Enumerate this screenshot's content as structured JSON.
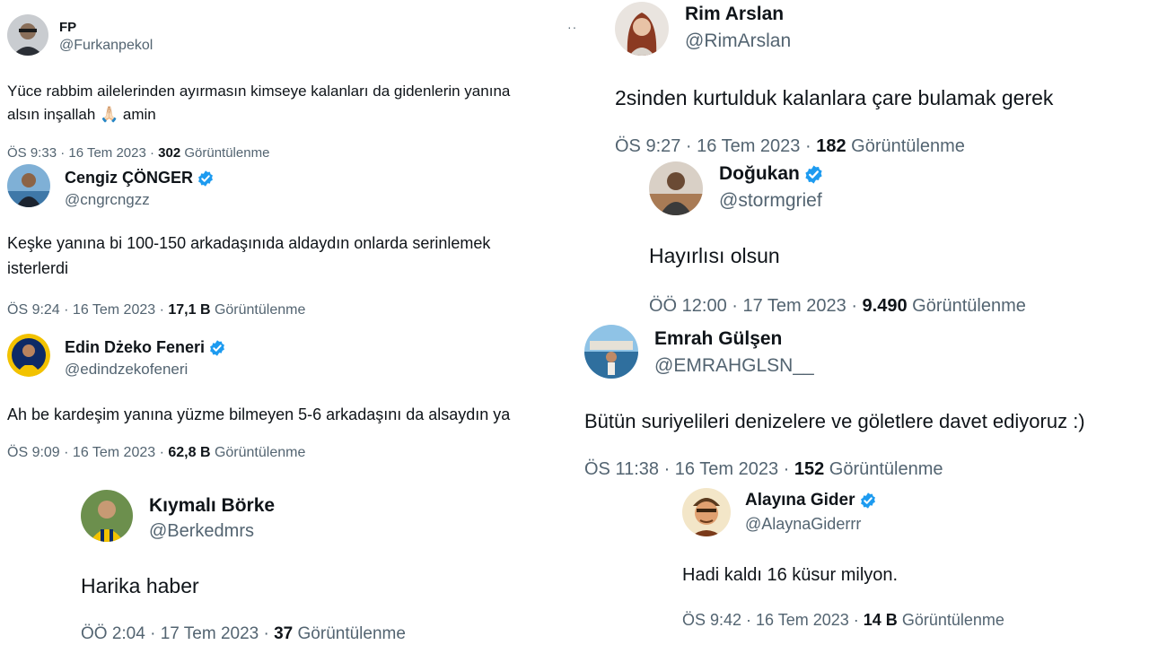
{
  "tweets": [
    {
      "name": "FP",
      "handle": "@Furkanpekol",
      "verified": false,
      "text_lines": [
        "Yüce rabbim ailelerinden ayırmasın kimseye kalanları da gidenlerin yanına",
        "alsın inşallah 🙏🏻 amin"
      ],
      "time": "ÖS 9:33 · 16 Tem 2023 · ",
      "views": "302",
      "views_label": " Görüntülenme",
      "more": "··"
    },
    {
      "name": "Cengiz ÇÖNGER",
      "handle": "@cngrcngzz",
      "verified": true,
      "text_lines": [
        "Keşke yanına bi 100-150 arkadaşınıda aldaydın onlarda serinlemek",
        "isterlerdi"
      ],
      "time": "ÖS 9:24 · 16 Tem 2023 · ",
      "views": "17,1 B",
      "views_label": " Görüntülenme"
    },
    {
      "name": "Edin Dżeko Feneri",
      "handle": "@edindzekofeneri",
      "verified": true,
      "text_lines": [
        "Ah be kardeşim yanına yüzme bilmeyen 5-6 arkadaşını da alsaydın ya"
      ],
      "time": "ÖS 9:09 · 16 Tem 2023 · ",
      "views": "62,8 B",
      "views_label": " Görüntülenme"
    },
    {
      "name": "Kıymalı Börke",
      "handle": "@Berkedmrs",
      "verified": false,
      "text_lines": [
        "Harika haber"
      ],
      "time": "ÖÖ 2:04 · 17 Tem 2023 · ",
      "views": "37",
      "views_label": " Görüntülenme"
    },
    {
      "name": "Rim Arslan",
      "handle": "@RimArslan",
      "verified": false,
      "text_lines": [
        "2sinden kurtulduk kalanlara çare bulamak gerek"
      ],
      "time": "ÖS 9:27 · 16 Tem 2023 · ",
      "views": "182",
      "views_label": " Görüntülenme"
    },
    {
      "name": "Doğukan",
      "handle": "@stormgrief",
      "verified": true,
      "text_lines": [
        "Hayırlısı olsun"
      ],
      "time": "ÖÖ 12:00 · 17 Tem 2023 · ",
      "views": "9.490",
      "views_label": " Görüntülenme"
    },
    {
      "name": "Emrah Gülşen",
      "handle": "@EMRAHGLSN__",
      "verified": false,
      "text_lines": [
        "Bütün suriyelileri denizelere ve göletlere davet ediyoruz :)"
      ],
      "time": "ÖS 11:38 · 16 Tem 2023 · ",
      "views": "152",
      "views_label": " Görüntülenme"
    },
    {
      "name": "Alayına Gider",
      "handle": "@AlaynaGiderrr",
      "verified": true,
      "text_lines": [
        "Hadi kaldı 16 küsur milyon."
      ],
      "time": "ÖS 9:42 · 16 Tem 2023 · ",
      "views": "14 B",
      "views_label": " Görüntülenme"
    }
  ],
  "colors": {
    "text": "#0f1419",
    "secondary": "#536471",
    "verified": "#1d9bf0"
  },
  "icons": {
    "verified": "verified-badge-icon",
    "more": "more-options-icon"
  }
}
